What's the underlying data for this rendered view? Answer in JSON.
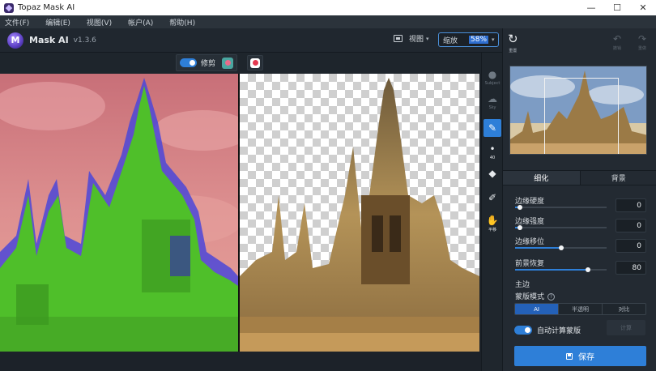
{
  "window": {
    "title": "Topaz Mask AI",
    "controls": {
      "minimize": "—",
      "maximize": "☐",
      "close": "✕"
    }
  },
  "menu": [
    {
      "label": "文件(F)"
    },
    {
      "label": "编辑(E)"
    },
    {
      "label": "视图(V)"
    },
    {
      "label": "帐户(A)"
    },
    {
      "label": "帮助(H)"
    }
  ],
  "app": {
    "logo_letter": "M",
    "name": "Mask AI",
    "version": "v1.3.6"
  },
  "toolbar": {
    "view_label": "视图",
    "zoom_label": "缩放",
    "zoom_value": "58%"
  },
  "canvas_tools": {
    "refine_label": "修剪",
    "refine_on": true
  },
  "side_tools": [
    {
      "icon": "subject-icon",
      "glyph": "●",
      "label": "Subject",
      "state": "dim"
    },
    {
      "icon": "sky-icon",
      "glyph": "☁",
      "label": "Sky",
      "state": "dim"
    },
    {
      "icon": "brush-icon",
      "glyph": "✎",
      "label": "",
      "state": "active"
    },
    {
      "icon": "brush-size-icon",
      "glyph": "•",
      "label": "40",
      "state": "bright"
    },
    {
      "icon": "fill-bucket-icon",
      "glyph": "◆",
      "label": "",
      "state": "bright"
    },
    {
      "icon": "eyedropper-icon",
      "glyph": "✐",
      "label": "",
      "state": "bright"
    },
    {
      "icon": "hand-icon",
      "glyph": "✋",
      "label": "平移",
      "state": "bright"
    }
  ],
  "right_panel": {
    "reset_label": "重置",
    "undo_label": "撤销",
    "redo_label": "重做",
    "tabs": [
      {
        "label": "细化",
        "active": true
      },
      {
        "label": "背景",
        "active": false
      }
    ],
    "sliders": [
      {
        "label": "边缘硬度",
        "value": "0",
        "fraction": 0.05
      },
      {
        "label": "边缘强度",
        "value": "0",
        "fraction": 0.05
      },
      {
        "label": "边缘移位",
        "value": "0",
        "fraction": 0.5
      },
      {
        "label": "前景恢复",
        "value": "80",
        "fraction": 0.8
      }
    ],
    "section_title": "主边",
    "mask_mode_label": "蒙版模式",
    "mask_modes": [
      {
        "label": "AI",
        "active": true
      },
      {
        "label": "半透明",
        "active": false
      },
      {
        "label": "对比",
        "active": false
      }
    ],
    "auto_compute_label": "自动计算蒙版",
    "auto_compute_on": true,
    "compute_button": "计算",
    "save_button": "保存"
  },
  "colors": {
    "accent": "#2e7fd8",
    "foreground_mask": "#4fbf2a",
    "background_mask": "#d98485",
    "edge_mask": "#4b47d8"
  }
}
